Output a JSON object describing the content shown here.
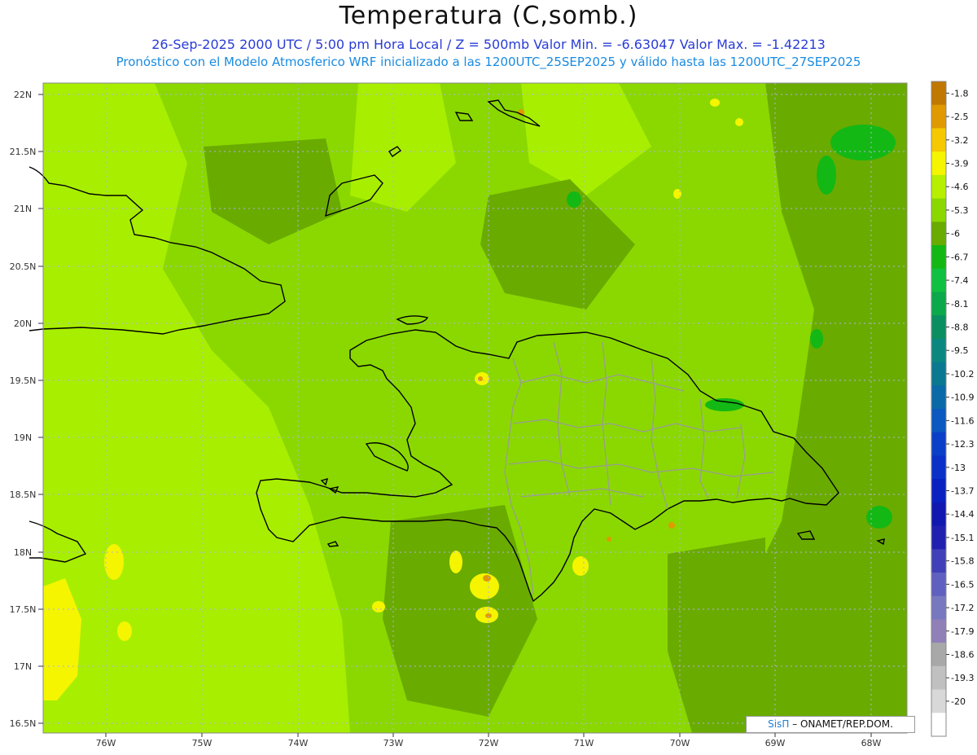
{
  "header": {
    "title": "Temperatura (C,somb.)",
    "subtitle_line1": "26-Sep-2025  2000 UTC / 5:00 pm Hora Local / Z = 500mb  Valor Min. = -6.63047  Valor Max. = -1.42213",
    "subtitle_line2": "Pronóstico con el Modelo Atmosferico WRF inicializado a las 1200UTC_25SEP2025 y válido hasta las  1200UTC_27SEP2025"
  },
  "axes": {
    "lat_labels": [
      "22N",
      "21.5N",
      "21N",
      "20.5N",
      "20N",
      "19.5N",
      "19N",
      "18.5N",
      "18N",
      "17.5N",
      "17N",
      "16.5N"
    ],
    "lon_labels": [
      "76W",
      "75W",
      "74W",
      "73W",
      "72W",
      "71W",
      "70W",
      "69W",
      "68W"
    ]
  },
  "colorbar": {
    "labels": [
      "-1.8",
      "-2.5",
      "-3.2",
      "-3.9",
      "-4.6",
      "-5.3",
      "-6",
      "-6.7",
      "-7.4",
      "-8.1",
      "-8.8",
      "-9.5",
      "-10.2",
      "-10.9",
      "-11.6",
      "-12.3",
      "-13",
      "-13.7",
      "-14.4",
      "-15.1",
      "-15.8",
      "-16.5",
      "-17.2",
      "-17.9",
      "-18.6",
      "-19.3",
      "-20"
    ],
    "colors": [
      "#c07800",
      "#e09a00",
      "#f5c800",
      "#f5f500",
      "#b6f000",
      "#8ad800",
      "#6aab00",
      "#14b814",
      "#10c040",
      "#0ca84c",
      "#0a9060",
      "#0a8880",
      "#0a7890",
      "#0a6aa8",
      "#0a58c0",
      "#0a40c8",
      "#0a30c8",
      "#0a20c0",
      "#1018b0",
      "#2020b0",
      "#4040b8",
      "#6060c0",
      "#7878c0",
      "#9080b8",
      "#a8a8a8",
      "#c0c0c0",
      "#d8d8d8",
      "#ffffff"
    ]
  },
  "credit": {
    "brand": "SisΠ",
    "text": "– ONAMET/REP.DOM."
  },
  "map_colors": {
    "light": "#a8ee00",
    "mid": "#8ad800",
    "dark": "#6aab00",
    "deep": "#14b814",
    "yellow": "#f5f500",
    "orange": "#e09a00",
    "coast": "#000000",
    "border": "#999999"
  }
}
